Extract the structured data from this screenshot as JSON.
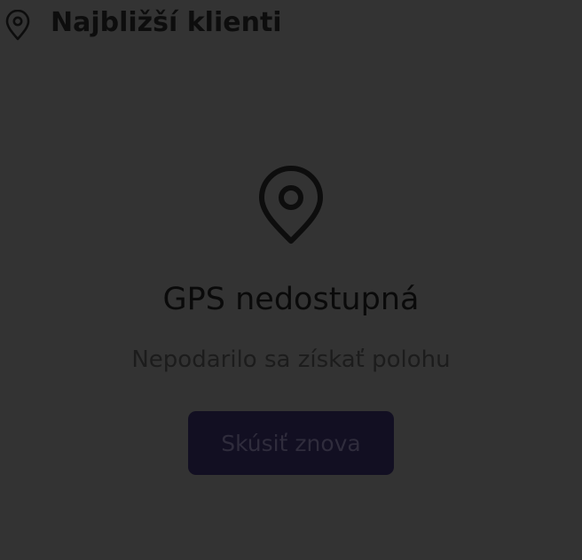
{
  "header": {
    "title": "Najbližší klienti",
    "icon": "map-pin-icon"
  },
  "empty_state": {
    "icon": "map-pin-icon",
    "title": "GPS nedostupná",
    "subtitle": "Nepodarilo sa získať polohu",
    "retry_label": "Skúsiť znova"
  },
  "colors": {
    "background": "#333333",
    "button_background": "#120f22",
    "button_text": "#2f2c3c",
    "title_text": "#0a0a0a",
    "subtitle_text": "#1c1c1c"
  }
}
